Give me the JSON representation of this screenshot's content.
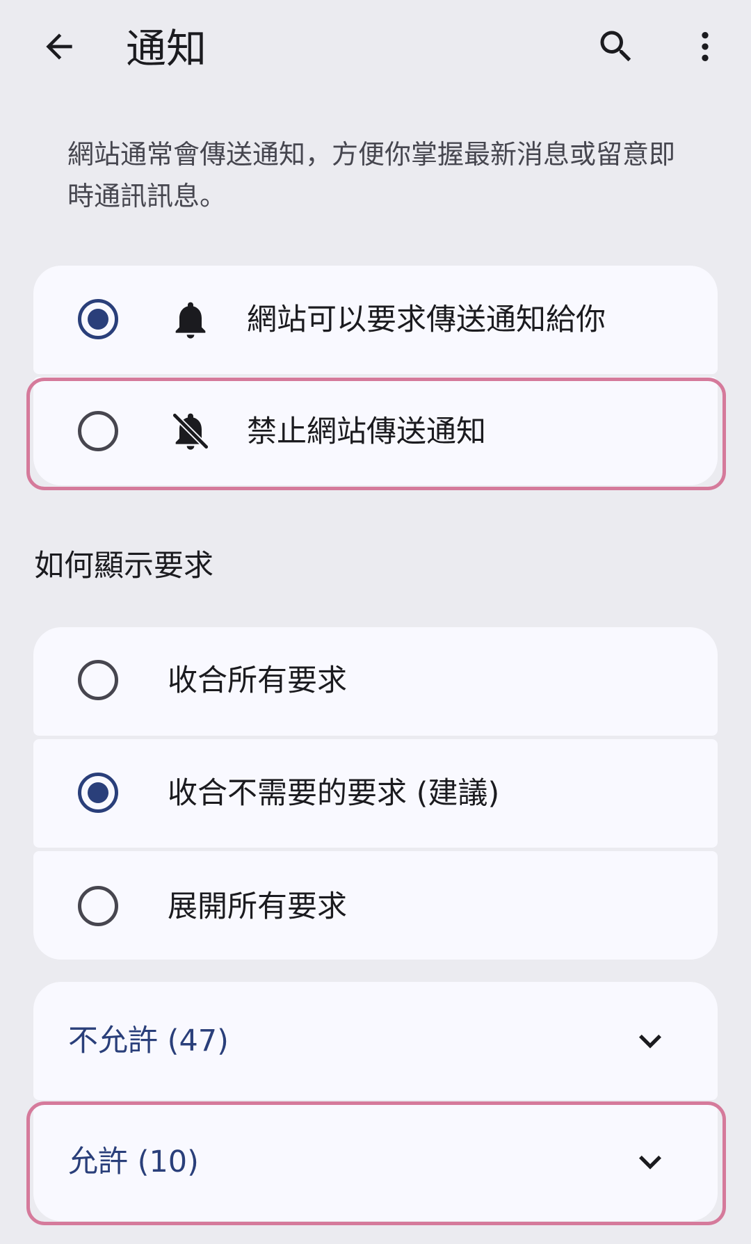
{
  "app_bar": {
    "title": "通知",
    "back_icon": "arrow-back-icon",
    "search_icon": "search-icon",
    "more_icon": "more-vert-icon"
  },
  "description": "網站通常會傳送通知，方便你掌握最新消息或留意即時通訊訊息。",
  "permission_options": [
    {
      "label": "網站可以要求傳送通知給你",
      "icon": "bell-icon",
      "selected": true
    },
    {
      "label": "禁止網站傳送通知",
      "icon": "bell-off-icon",
      "selected": false
    }
  ],
  "request_display": {
    "section_title": "如何顯示要求",
    "options": [
      {
        "label": "收合所有要求",
        "selected": false
      },
      {
        "label": "收合不需要的要求 (建議)",
        "selected": true
      },
      {
        "label": "展開所有要求",
        "selected": false
      }
    ]
  },
  "site_lists": [
    {
      "label": "不允許 (47)",
      "icon": "chevron-down-icon"
    },
    {
      "label": "允許 (10)",
      "icon": "chevron-down-icon"
    }
  ],
  "colors": {
    "background": "#ebebf0",
    "card": "#f9f9ff",
    "accent": "#2a3f7a",
    "highlight": "#d57a9b"
  }
}
